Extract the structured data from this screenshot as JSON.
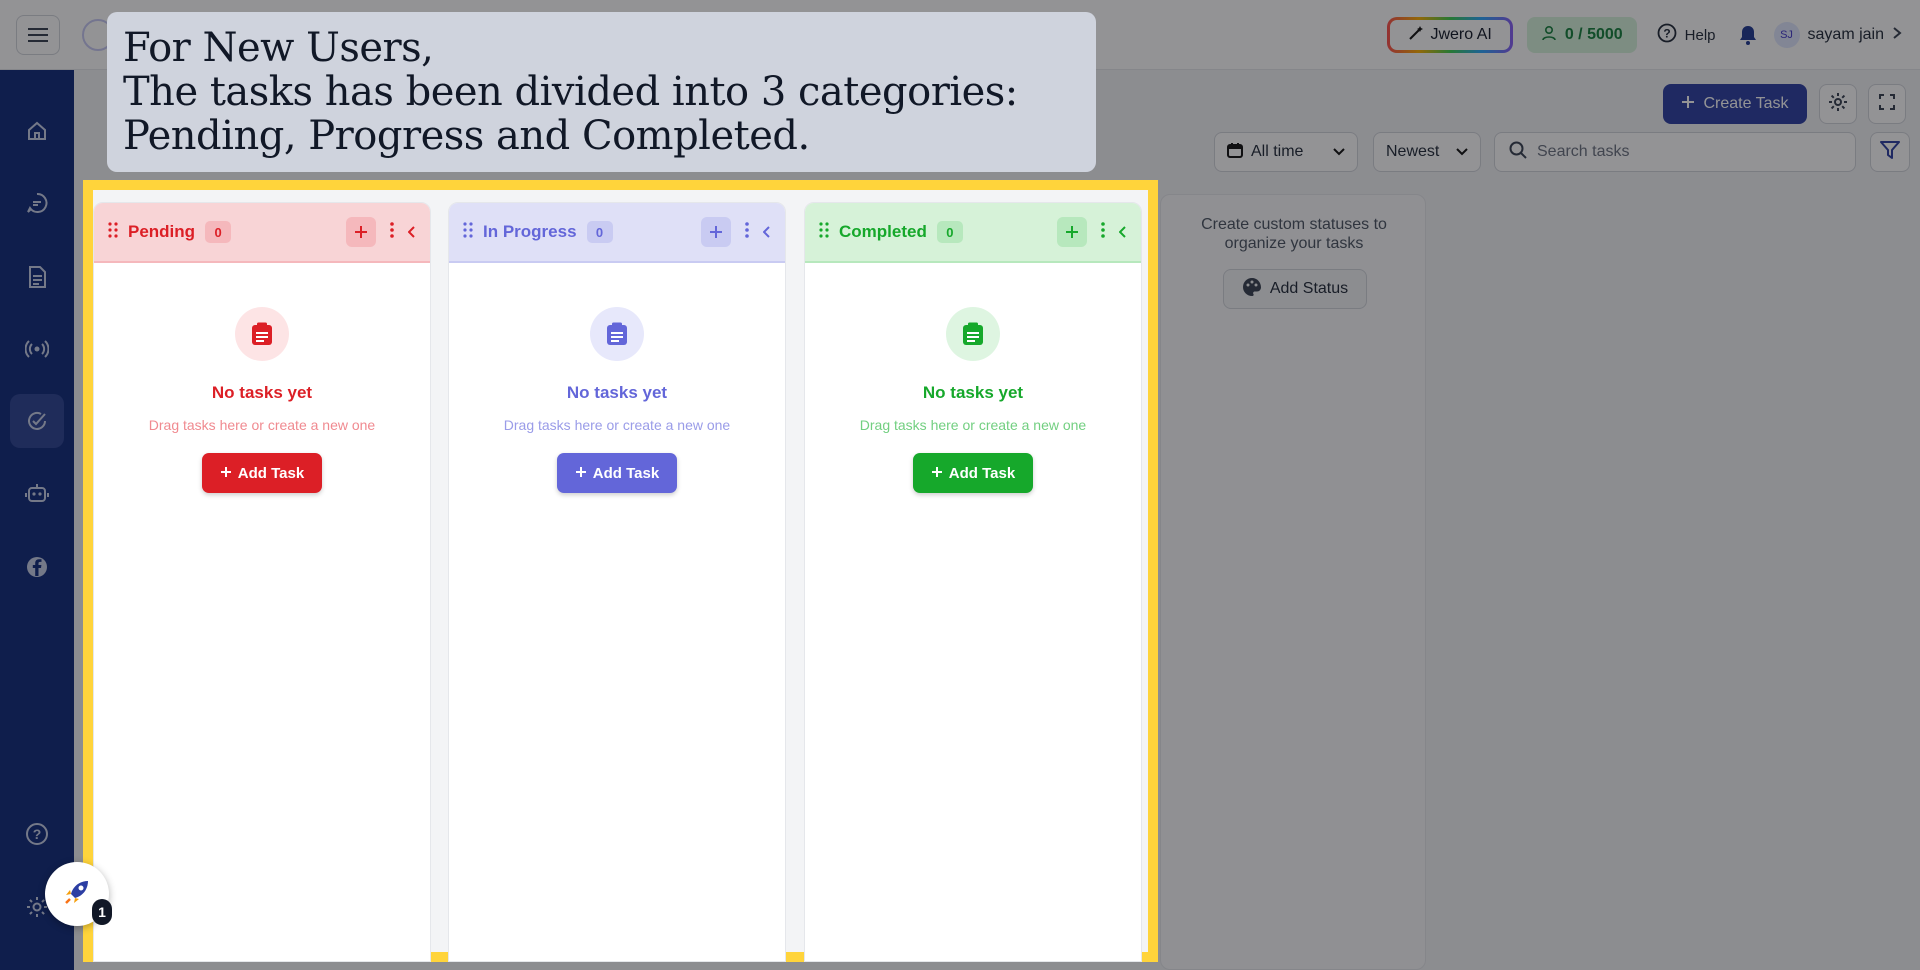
{
  "topbar": {
    "ai_label": "Jwero AI",
    "credits": "0 / 5000",
    "help_label": "Help",
    "user_initials": "SJ",
    "user_name": "sayam jain"
  },
  "toolbar": {
    "create_label": "Create Task",
    "date_filter": "All time",
    "sort": "Newest",
    "search_placeholder": "Search tasks"
  },
  "status_panel": {
    "text": "Create custom statuses to organize your tasks",
    "button": "Add Status"
  },
  "columns": [
    {
      "title": "Pending",
      "count": "0",
      "empty_title": "No tasks yet",
      "empty_sub": "Drag tasks here or create a new one",
      "add_label": "Add Task",
      "accent": "#dc1f26",
      "head_bg": "#f8d4d6",
      "count_bg": "#f5b8bc",
      "icon_bg": "#fde4e5",
      "sub_color": "#f08a90"
    },
    {
      "title": "In Progress",
      "count": "0",
      "empty_title": "No tasks yet",
      "empty_sub": "Drag tasks here or create a new one",
      "add_label": "Add Task",
      "accent": "#6366d9",
      "head_bg": "#dfe0f7",
      "count_bg": "#c9cbf2",
      "icon_bg": "#e7e8fb",
      "sub_color": "#9a9ce8"
    },
    {
      "title": "Completed",
      "count": "0",
      "empty_title": "No tasks yet",
      "empty_sub": "Drag tasks here or create a new one",
      "add_label": "Add Task",
      "accent": "#16a82b",
      "head_bg": "#d6f2d8",
      "count_bg": "#b7e8bd",
      "icon_bg": "#def5e1",
      "sub_color": "#72cf80"
    }
  ],
  "tooltip": {
    "line1": "For New Users,",
    "line2": "The tasks has been divided into 3 categories:",
    "line3": "Pending, Progress and Completed."
  },
  "onboarding": {
    "step": "1"
  },
  "sidebar": {
    "items": [
      "home-icon",
      "chat-icon",
      "document-icon",
      "broadcast-icon",
      "tasks-icon",
      "bot-icon",
      "facebook-icon",
      "help-icon",
      "settings-icon"
    ],
    "active": "tasks-icon"
  },
  "colors": {
    "sidebar": "#0f2a7a",
    "primary": "#2c3ea3",
    "highlight": "#ffd43b"
  }
}
